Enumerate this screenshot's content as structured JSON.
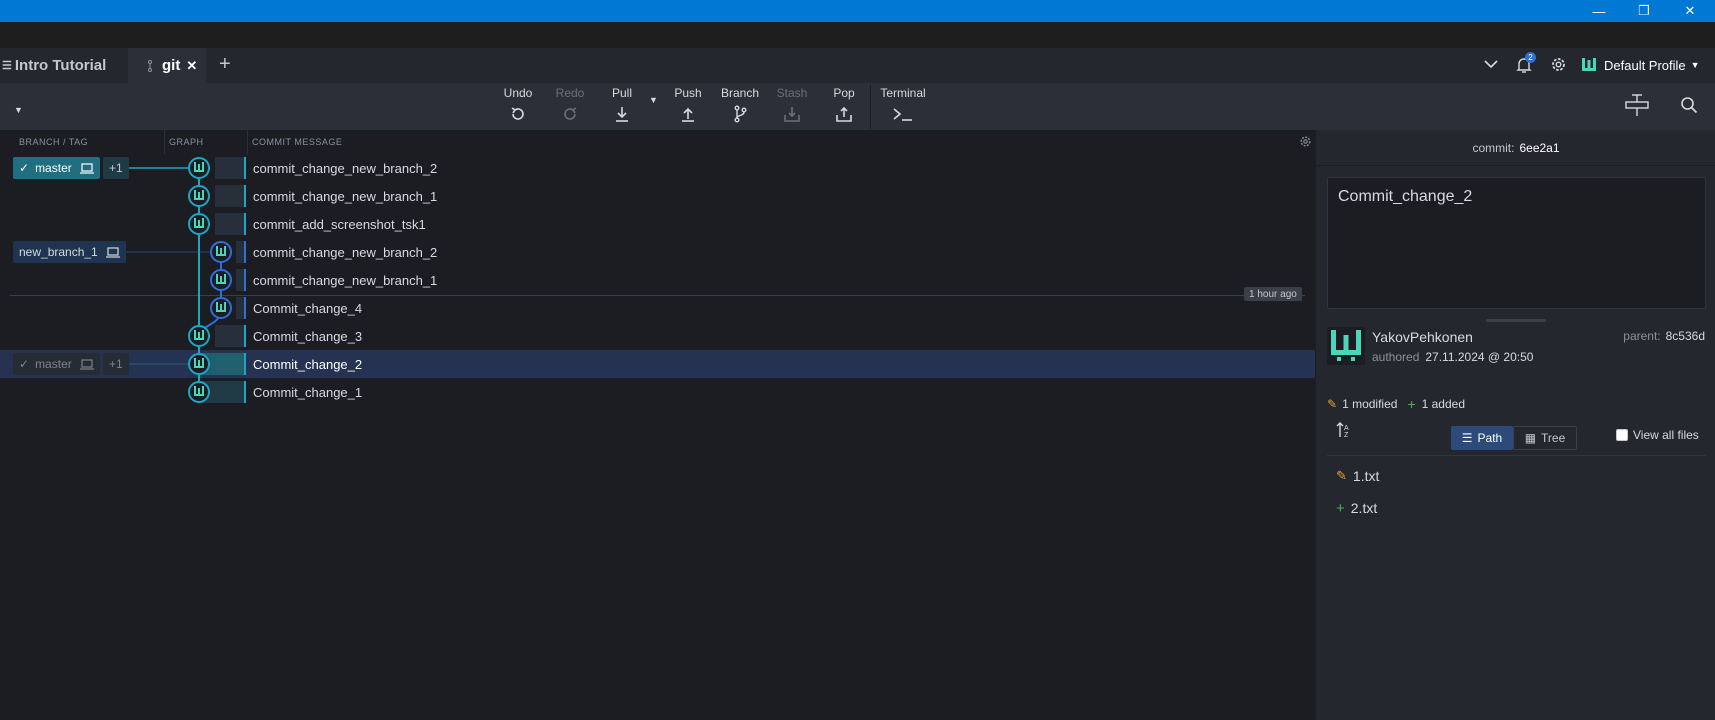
{
  "window": {
    "minimize_icon": "minimize-icon",
    "restore_icon": "restore-icon",
    "close_icon": "close-icon"
  },
  "tabs": [
    {
      "label": "Intro Tutorial",
      "icon": "graduation-cap-icon"
    },
    {
      "label": "git",
      "icon": "branch-icon",
      "close": "✕"
    }
  ],
  "tabbar_right": {
    "notification_count": "2",
    "profile_label": "Default Profile"
  },
  "toolbar": {
    "undo": "Undo",
    "redo": "Redo",
    "pull": "Pull",
    "push": "Push",
    "branch": "Branch",
    "stash": "Stash",
    "pop": "Pop",
    "terminal": "Terminal"
  },
  "columns": {
    "branch_tag": "BRANCH / TAG",
    "graph": "GRAPH",
    "commit_message": "COMMIT MESSAGE"
  },
  "branches": {
    "master_head": {
      "label": "master",
      "extra": "+1"
    },
    "new_branch_1": {
      "label": "new_branch_1"
    },
    "master_remote": {
      "label": "master",
      "extra": "+1"
    }
  },
  "commits": [
    {
      "message": "commit_change_new_branch_2"
    },
    {
      "message": "commit_change_new_branch_1"
    },
    {
      "message": "commit_add_screenshot_tsk1"
    },
    {
      "message": "commit_change_new_branch_2"
    },
    {
      "message": "commit_change_new_branch_1"
    },
    {
      "message": "Commit_change_4"
    },
    {
      "message": "Commit_change_3"
    },
    {
      "message": "Commit_change_2"
    },
    {
      "message": "Commit_change_1"
    }
  ],
  "time_marker": "1 hour ago",
  "detail": {
    "commit_label": "commit:",
    "commit_sha": "6ee2a1",
    "message": "Commit_change_2",
    "author": "YakovPehkonen",
    "authored_label": "authored",
    "authored_date": "27.11.2024 @ 20:50",
    "parent_label": "parent:",
    "parent_sha": "8c536d",
    "modified_summary": "1 modified",
    "added_summary": "1 added",
    "path_label": "Path",
    "tree_label": "Tree",
    "view_all_label": "View all files",
    "files": [
      {
        "name": "1.txt",
        "status": "modified"
      },
      {
        "name": "2.txt",
        "status": "added"
      }
    ]
  },
  "colors": {
    "accent_teal": "#1ea7c4",
    "accent_blue": "#2e6fd8",
    "selected_row": "#253252",
    "titlebar": "#0078d4"
  }
}
